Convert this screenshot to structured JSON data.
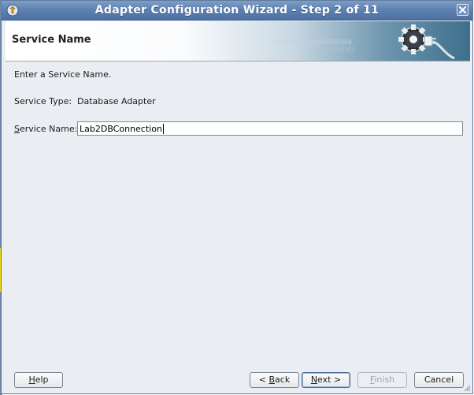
{
  "window": {
    "title": "Adapter Configuration Wizard - Step 2 of 11"
  },
  "header": {
    "title": "Service Name",
    "binary_line1": "01010101010101010101010",
    "binary_line2": "0101010101"
  },
  "form": {
    "instruction": "Enter a Service Name.",
    "service_type_label": "Service Type:",
    "service_type_value": "Database Adapter",
    "service_name_mnemonic": "S",
    "service_name_label_rest": "ervice Name:",
    "service_name_value": "Lab2DBConnection"
  },
  "buttons": {
    "help": {
      "mnemonic": "H",
      "rest": "elp"
    },
    "back": {
      "prefix": "< ",
      "mnemonic": "B",
      "rest": "ack"
    },
    "next": {
      "mnemonic": "N",
      "rest": "ext >"
    },
    "finish": {
      "mnemonic": "F",
      "rest": "inish"
    },
    "cancel": {
      "label": "Cancel"
    }
  },
  "colors": {
    "titlebar": "#5f82b3",
    "header_accent": "#3e6f8c",
    "background": "#eaedf1"
  },
  "icons": {
    "app": "adapter-wizard-icon",
    "close": "close-icon",
    "header_art": "gear-plug-icon",
    "grip": "resize-grip-icon"
  }
}
